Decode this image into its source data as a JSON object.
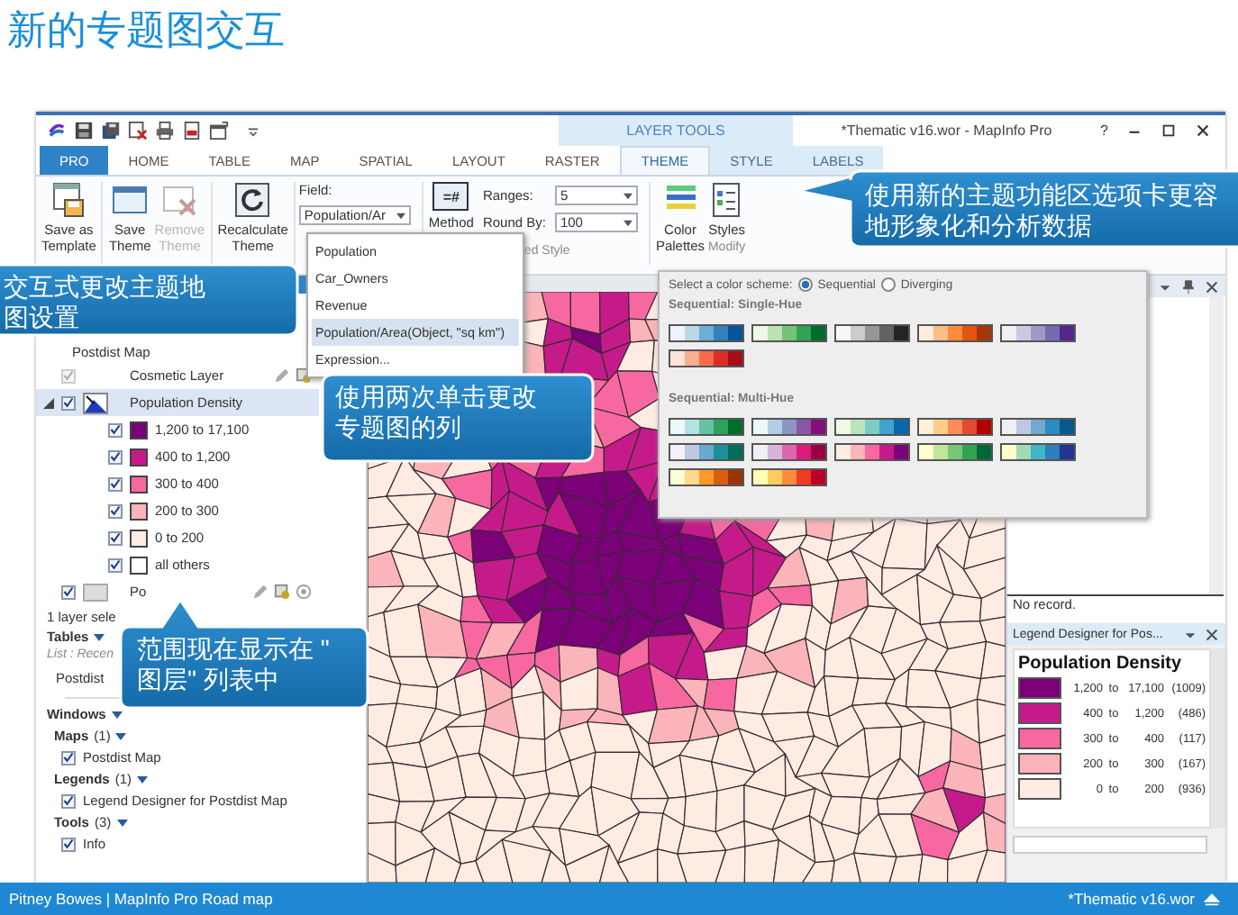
{
  "slide_title": "新的专题图交互",
  "window": {
    "title": "*Thematic v16.wor - MapInfo Pro",
    "context_label": "LAYER TOOLS",
    "help": "?"
  },
  "tabs": [
    {
      "label": "PRO",
      "kind": "file",
      "selected": false
    },
    {
      "label": "HOME",
      "kind": "tab",
      "selected": false
    },
    {
      "label": "TABLE",
      "kind": "tab",
      "selected": false
    },
    {
      "label": "MAP",
      "kind": "tab",
      "selected": false
    },
    {
      "label": "SPATIAL",
      "kind": "tab",
      "selected": false
    },
    {
      "label": "LAYOUT",
      "kind": "tab",
      "selected": false
    },
    {
      "label": "RASTER",
      "kind": "tab",
      "selected": false
    },
    {
      "label": "THEME",
      "kind": "context",
      "selected": true
    },
    {
      "label": "STYLE",
      "kind": "context",
      "selected": false
    },
    {
      "label": "LABELS",
      "kind": "context",
      "selected": false
    }
  ],
  "ribbon": {
    "buttons": [
      {
        "label": "Save as\nTemplate",
        "kind": "template",
        "disabled": false
      },
      {
        "label": "Save\nTheme",
        "kind": "save",
        "disabled": false
      },
      {
        "label": "Remove\nTheme",
        "kind": "remove",
        "disabled": true
      },
      {
        "label": "Recalculate\nTheme",
        "kind": "recalc",
        "disabled": false
      }
    ],
    "field": {
      "label": "Field:",
      "value": "Population/Ar"
    },
    "method": {
      "icon_text": "=#",
      "label": "Method"
    },
    "ranges": {
      "label": "Ranges:",
      "value": "5"
    },
    "round_by": {
      "label": "Round By:",
      "value": "100"
    },
    "color_palettes": {
      "label": "Color\nPalettes"
    },
    "styles": {
      "label": "Styles"
    },
    "group_labels": [
      "ed Style",
      "Modify"
    ]
  },
  "field_menu": [
    {
      "label": "Population",
      "selected": false
    },
    {
      "label": "Car_Owners",
      "selected": false
    },
    {
      "label": "Revenue",
      "selected": false
    },
    {
      "label": "Population/Area(Object, \"sq km\")",
      "selected": true
    },
    {
      "label": "Expression...",
      "selected": false
    }
  ],
  "color_scheme_popup": {
    "prompt": "Select a color scheme:",
    "options": [
      {
        "label": "Sequential",
        "selected": true
      },
      {
        "label": "Diverging",
        "selected": false
      }
    ],
    "sections": [
      {
        "title": "Sequential: Single-Hue",
        "palettes": [
          {
            "swatches": [
              {
                "color": "#eff3ff"
              },
              {
                "color": "#bdd7e7"
              },
              {
                "color": "#6baed6"
              },
              {
                "color": "#3182bd"
              },
              {
                "color": "#08519c"
              }
            ]
          },
          {
            "swatches": [
              {
                "color": "#edf8e9"
              },
              {
                "color": "#bae4b3"
              },
              {
                "color": "#74c476"
              },
              {
                "color": "#31a354"
              },
              {
                "color": "#006d2c"
              }
            ]
          },
          {
            "swatches": [
              {
                "color": "#f7f7f7"
              },
              {
                "color": "#cccccc"
              },
              {
                "color": "#969696"
              },
              {
                "color": "#636363"
              },
              {
                "color": "#252525"
              }
            ]
          },
          {
            "swatches": [
              {
                "color": "#feedde"
              },
              {
                "color": "#fdbe85"
              },
              {
                "color": "#fd8d3c"
              },
              {
                "color": "#e6550d"
              },
              {
                "color": "#a63603"
              }
            ]
          },
          {
            "swatches": [
              {
                "color": "#f2f0f7"
              },
              {
                "color": "#cbc9e2"
              },
              {
                "color": "#9e9ac8"
              },
              {
                "color": "#756bb1"
              },
              {
                "color": "#54278f"
              }
            ]
          },
          {
            "swatches": [
              {
                "color": "#fee5d9"
              },
              {
                "color": "#fcae91"
              },
              {
                "color": "#fb6a4a"
              },
              {
                "color": "#de2d26"
              },
              {
                "color": "#a50f15"
              }
            ]
          }
        ]
      },
      {
        "title": "Sequential: Multi-Hue",
        "palettes": [
          {
            "swatches": [
              {
                "color": "#edf8fb"
              },
              {
                "color": "#b2e2e2"
              },
              {
                "color": "#66c2a4"
              },
              {
                "color": "#2ca25f"
              },
              {
                "color": "#006d2c"
              }
            ]
          },
          {
            "swatches": [
              {
                "color": "#edf8fb"
              },
              {
                "color": "#b3cde3"
              },
              {
                "color": "#8c96c6"
              },
              {
                "color": "#8856a7"
              },
              {
                "color": "#810f7c"
              }
            ]
          },
          {
            "swatches": [
              {
                "color": "#f0f9e8"
              },
              {
                "color": "#bae4bc"
              },
              {
                "color": "#7bccc4"
              },
              {
                "color": "#43a2ca"
              },
              {
                "color": "#0868ac"
              }
            ]
          },
          {
            "swatches": [
              {
                "color": "#fef0d9"
              },
              {
                "color": "#fdcc8a"
              },
              {
                "color": "#fc8d59"
              },
              {
                "color": "#e34a33"
              },
              {
                "color": "#b30000"
              }
            ]
          },
          {
            "swatches": [
              {
                "color": "#f1eef6"
              },
              {
                "color": "#bdc9e1"
              },
              {
                "color": "#74a9cf"
              },
              {
                "color": "#2b8cbe"
              },
              {
                "color": "#045a8d"
              }
            ]
          },
          {
            "swatches": [
              {
                "color": "#f6eff7"
              },
              {
                "color": "#bdc9e1"
              },
              {
                "color": "#67a9cf"
              },
              {
                "color": "#1c9099"
              },
              {
                "color": "#016c59"
              }
            ]
          },
          {
            "swatches": [
              {
                "color": "#f1eef6"
              },
              {
                "color": "#d7b5d8"
              },
              {
                "color": "#df65b0"
              },
              {
                "color": "#dd1c77"
              },
              {
                "color": "#980043"
              }
            ]
          },
          {
            "swatches": [
              {
                "color": "#feebe2"
              },
              {
                "color": "#fbb4b9"
              },
              {
                "color": "#f768a1"
              },
              {
                "color": "#c51b8a"
              },
              {
                "color": "#7a0177"
              }
            ]
          },
          {
            "swatches": [
              {
                "color": "#ffffcc"
              },
              {
                "color": "#c2e699"
              },
              {
                "color": "#78c679"
              },
              {
                "color": "#31a354"
              },
              {
                "color": "#006837"
              }
            ]
          },
          {
            "swatches": [
              {
                "color": "#ffffcc"
              },
              {
                "color": "#a1dab4"
              },
              {
                "color": "#41b6c4"
              },
              {
                "color": "#2c7fb8"
              },
              {
                "color": "#253494"
              }
            ]
          },
          {
            "swatches": [
              {
                "color": "#ffffd4"
              },
              {
                "color": "#fed98e"
              },
              {
                "color": "#fe9929"
              },
              {
                "color": "#d95f0e"
              },
              {
                "color": "#993404"
              }
            ]
          },
          {
            "swatches": [
              {
                "color": "#ffffb2"
              },
              {
                "color": "#fecc5c"
              },
              {
                "color": "#fd8d3c"
              },
              {
                "color": "#f03b20"
              },
              {
                "color": "#bd0026"
              }
            ]
          }
        ]
      }
    ]
  },
  "layer_panel": {
    "map_name": "Postdist Map",
    "layers": [
      {
        "name": "Cosmetic Layer",
        "kind": "cosmetic",
        "checked": true,
        "selected": false
      },
      {
        "name": "Population Density",
        "kind": "theme",
        "checked": true,
        "selected": true,
        "expanded": true,
        "children": [
          {
            "label": "1,200 to 17,100",
            "color": "#7a0177",
            "checked": true
          },
          {
            "label": "400 to 1,200",
            "color": "#c51b8a",
            "checked": true
          },
          {
            "label": "300 to 400",
            "color": "#f768a1",
            "checked": true
          },
          {
            "label": "200 to 300",
            "color": "#fbb4b9",
            "checked": true
          },
          {
            "label": "0 to 200",
            "color": "#feebe2",
            "checked": true
          },
          {
            "label": "all others",
            "color": "#ffffff",
            "checked": true
          }
        ]
      },
      {
        "name": "Po",
        "kind": "region",
        "checked": true,
        "selected": false
      }
    ],
    "status": "1 layer sele"
  },
  "explorer": {
    "tables": {
      "title": "Tables",
      "filter": "List : Recen",
      "items": [
        "Postdist"
      ]
    },
    "windows": {
      "title": "Windows",
      "groups": [
        {
          "title": "Maps",
          "count": "(1)",
          "items": [
            {
              "label": "Postdist Map",
              "checked": true
            }
          ]
        },
        {
          "title": "Legends",
          "count": "(1)",
          "items": [
            {
              "label": "Legend Designer for Postdist Map",
              "checked": true
            }
          ]
        },
        {
          "title": "Tools",
          "count": "(3)",
          "items": [
            {
              "label": "Info",
              "checked": true
            }
          ]
        }
      ]
    }
  },
  "info_panel": {
    "status": "No record."
  },
  "legend_designer": {
    "title": "Legend Designer for Pos...",
    "heading": "Population Density",
    "rows": [
      {
        "color": "#7a0177",
        "from": "1,200",
        "to_word": "to",
        "to": "17,100",
        "count": "(1009)"
      },
      {
        "color": "#c51b8a",
        "from": "400",
        "to_word": "to",
        "to": "1,200",
        "count": "(486)"
      },
      {
        "color": "#f768a1",
        "from": "300",
        "to_word": "to",
        "to": "400",
        "count": "(117)"
      },
      {
        "color": "#fbb4b9",
        "from": "200",
        "to_word": "to",
        "to": "300",
        "count": "(167)"
      },
      {
        "color": "#feebe2",
        "from": "0",
        "to_word": "to",
        "to": "200",
        "count": "(936)"
      }
    ]
  },
  "status_bar": {
    "left": "Pitney Bowes | MapInfo Pro Road map",
    "right": "*Thematic v16.wor"
  },
  "callouts": [
    {
      "lines": [
        "使用新的主题功能区选项卡更容",
        "地形象化和分析数据"
      ]
    },
    {
      "lines": [
        "交互式更改主题地",
        "图设置"
      ]
    },
    {
      "lines": [
        "使用两次单击更改",
        "专题图的列"
      ]
    },
    {
      "lines": [
        "范围现在显示在 \"",
        "图层\" 列表中"
      ]
    }
  ]
}
